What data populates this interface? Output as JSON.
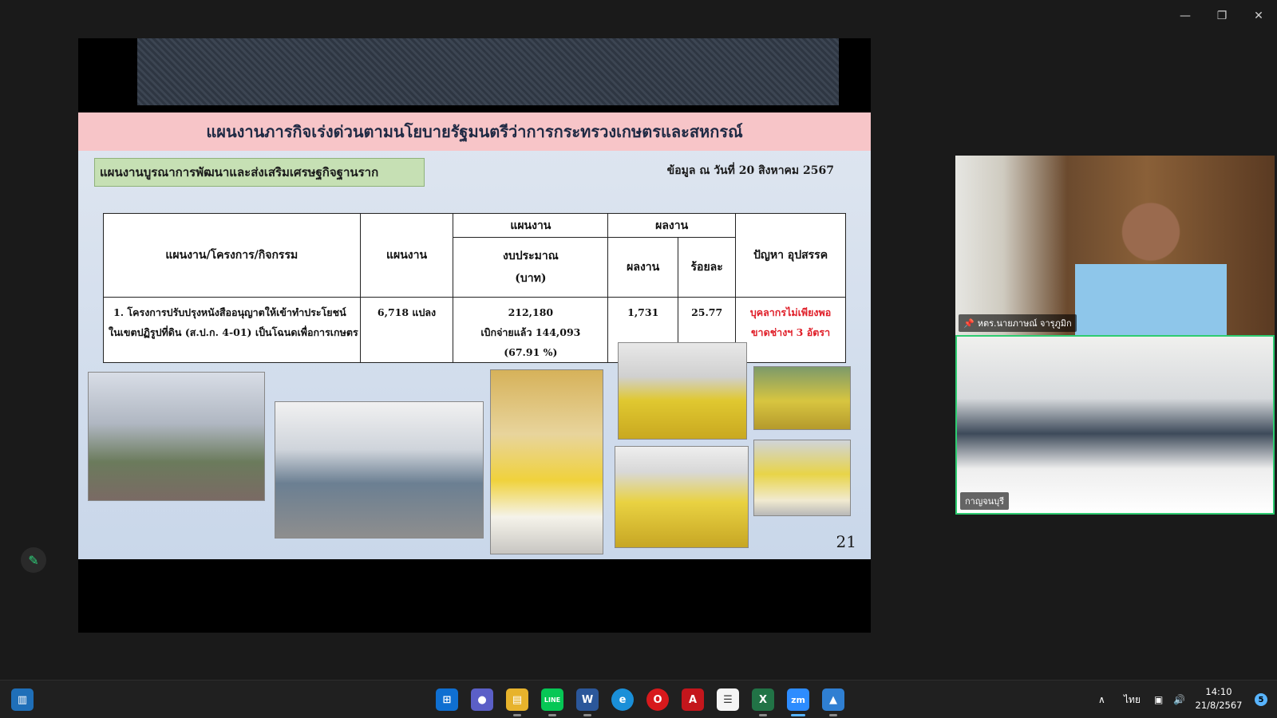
{
  "window": {
    "minimize_icon": "minimize-icon",
    "restore_icon": "restore-icon",
    "close_icon": "close-icon"
  },
  "slide": {
    "title": "แผนงานภารกิจเร่งด่วนตามนโยบายรัฐมนตรีว่าการกระทรวงเกษตรและสหกรณ์",
    "plan_label": "แผนงานบูรณาการพัฒนาและส่งเสริมเศรษฐกิจฐานราก",
    "data_date": "ข้อมูล ณ วันที่ 20 สิงหาคม 2567",
    "page_number": "21",
    "table": {
      "headers": {
        "project": "แผนงาน/โครงการ/กิจกรรม",
        "plan": "แผนงาน",
        "plan_group": "แผนงาน",
        "budget_line1": "งบประมาณ",
        "budget_line2": "(บาท)",
        "result_group": "ผลงาน",
        "result": "ผลงาน",
        "percent": "ร้อยละ",
        "problem": "ปัญหา อุปสรรค"
      },
      "row": {
        "project_line1": "1. โครงการปรับปรุงหนังสืออนุญาตให้เข้าทำประโยชน์",
        "project_line2": "ในเขตปฏิรูปที่ดิน (ส.ป.ก. 4-01) เป็นโฉนดเพื่อการเกษตร",
        "plan": "6,718 แปลง",
        "budget": "212,180",
        "budget_spent": "เบิกจ่ายแล้ว 144,093",
        "budget_percent": "(67.91 %)",
        "result": "1,731",
        "percent": "25.77",
        "problem_line1": "บุคลากรไม่เพียงพอ",
        "problem_line2": "ขาดช่างฯ 3 อัตรา"
      }
    }
  },
  "participants": [
    {
      "name": "หตร.นายภาษณ์ จารุภูมิก",
      "pinned": true,
      "pin_icon": "pin-icon"
    },
    {
      "name": "กาญจนบุรี",
      "active_speaker": true
    }
  ],
  "annotate": {
    "icon": "pencil-icon"
  },
  "taskbar": {
    "apps": [
      "start",
      "widgets",
      "teams-chat",
      "file-explorer",
      "line",
      "word",
      "edge",
      "opera",
      "acrobat",
      "file",
      "excel",
      "zoom",
      "photos"
    ],
    "zoom_label": "zm",
    "word_label": "W",
    "excel_label": "X",
    "line_label": "LINE",
    "language": "ไทย",
    "time": "14:10",
    "date": "21/8/2567",
    "notification_count": "5"
  }
}
